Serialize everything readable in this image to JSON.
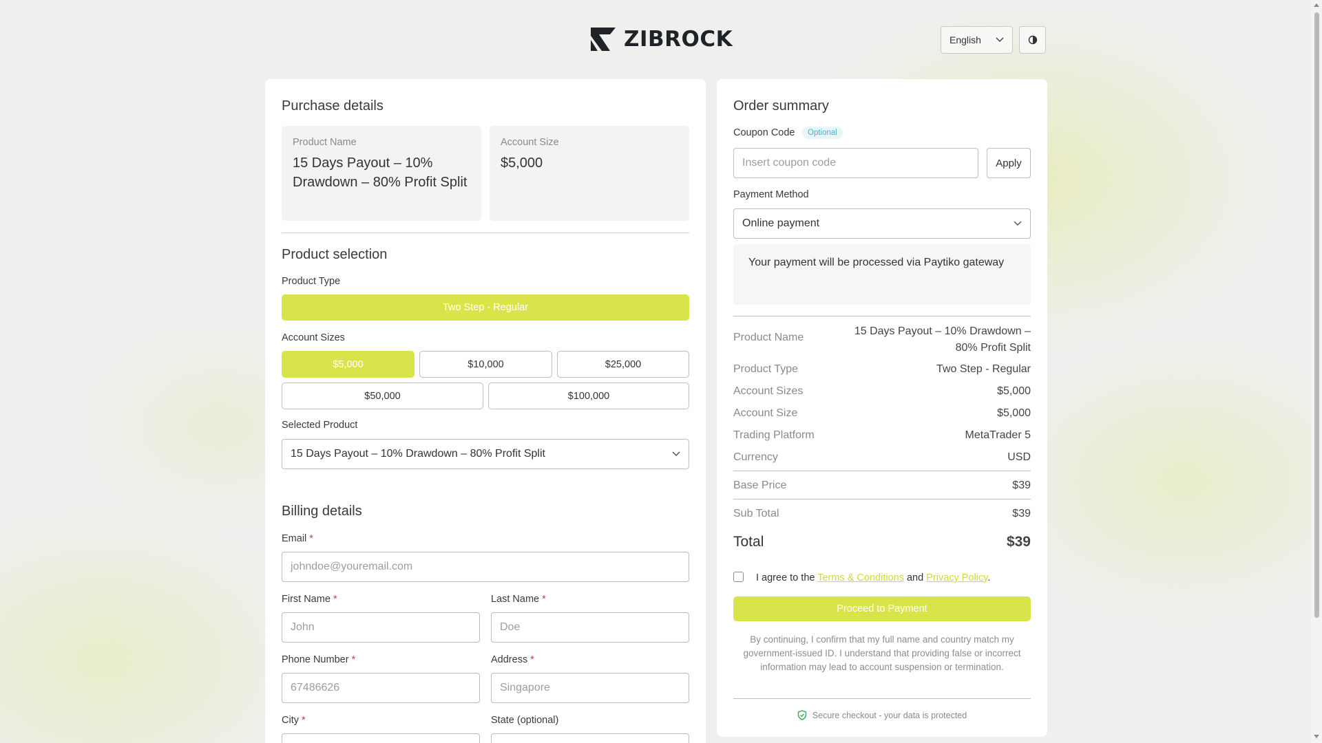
{
  "header": {
    "brand": "ZIBROCK",
    "language": "English"
  },
  "purchase": {
    "title": "Purchase details",
    "product_name_label": "Product Name",
    "product_name_value": "15 Days Payout – 10% Drawdown – 80% Profit Split",
    "account_size_label": "Account Size",
    "account_size_value": "$5,000"
  },
  "product_selection": {
    "title": "Product selection",
    "type_label": "Product Type",
    "type_value": "Two Step - Regular",
    "sizes_label": "Account Sizes",
    "sizes": [
      "$5,000",
      "$10,000",
      "$25,000",
      "$50,000",
      "$100,000"
    ],
    "selected_size_index": 0,
    "selected_product_label": "Selected Product",
    "selected_product_value": "15 Days Payout – 10% Drawdown – 80% Profit Split"
  },
  "billing": {
    "title": "Billing details",
    "email_label": "Email",
    "email_placeholder": "johndoe@youremail.com",
    "first_name_label": "First Name",
    "first_name_placeholder": "John",
    "last_name_label": "Last Name",
    "last_name_placeholder": "Doe",
    "phone_label": "Phone Number",
    "phone_placeholder": "67486626",
    "address_label": "Address",
    "address_placeholder": "Singapore",
    "city_label": "City",
    "state_label": "State (optional)",
    "required_mark": "*"
  },
  "order": {
    "title": "Order summary",
    "coupon_label": "Coupon Code",
    "coupon_badge": "Optional",
    "coupon_placeholder": "Insert coupon code",
    "apply_label": "Apply",
    "payment_label": "Payment Method",
    "payment_value": "Online payment",
    "payment_note": "Your payment will be processed via Paytiko gateway",
    "rows": [
      {
        "label": "Product Name",
        "value": "15 Days Payout – 10% Drawdown – 80% Profit Split"
      },
      {
        "label": "Product Type",
        "value": "Two Step - Regular"
      },
      {
        "label": "Account Sizes",
        "value": "$5,000"
      },
      {
        "label": "Account Size",
        "value": "$5,000"
      },
      {
        "label": "Trading Platform",
        "value": "MetaTrader 5"
      },
      {
        "label": "Currency",
        "value": "USD"
      }
    ],
    "base_price_label": "Base Price",
    "base_price_value": "$39",
    "sub_total_label": "Sub Total",
    "sub_total_value": "$39",
    "total_label": "Total",
    "total_value": "$39",
    "agree_prefix": "I agree to the",
    "terms_link": "Terms & Conditions",
    "agree_and": "and",
    "privacy_link": "Privacy Policy",
    "agree_suffix": ".",
    "proceed_label": "Proceed to Payment",
    "disclaimer": "By continuing, I confirm that my full name and country match my government-issued ID. I understand that providing false or incorrect information may lead to account suspension or termination.",
    "secure_text": "Secure checkout - your data is protected"
  },
  "colors": {
    "accent": "#d9e44a",
    "link": "#cfd93b",
    "required": "#e0343a",
    "badge_text": "#3fb6c8",
    "secure_icon": "#35a853"
  }
}
